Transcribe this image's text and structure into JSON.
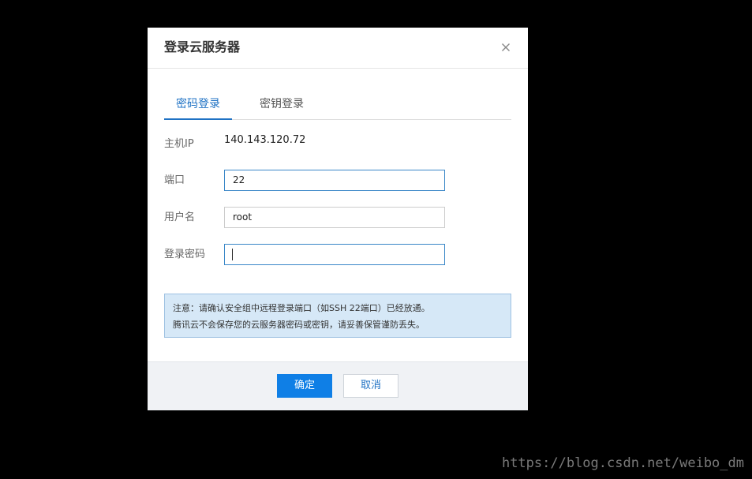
{
  "dialog": {
    "title": "登录云服务器",
    "close_icon": "close-icon"
  },
  "tabs": [
    {
      "label": "密码登录",
      "active": true
    },
    {
      "label": "密钥登录",
      "active": false
    }
  ],
  "form": {
    "host_ip": {
      "label": "主机IP",
      "value": "140.143.120.72"
    },
    "port": {
      "label": "端口",
      "value": "22"
    },
    "username": {
      "label": "用户名",
      "value": "root"
    },
    "password": {
      "label": "登录密码",
      "value": ""
    }
  },
  "notice": {
    "line1": "注意：请确认安全组中远程登录端口（如SSH 22端口）已经放通。",
    "line2": "腾讯云不会保存您的云服务器密码或密钥，请妥善保管谨防丢失。"
  },
  "footer": {
    "confirm_label": "确定",
    "cancel_label": "取消"
  },
  "watermark": "https://blog.csdn.net/weibo_dm",
  "colors": {
    "accent": "#1f72c4",
    "primary_button": "#0f7fe6",
    "notice_bg": "#d6e8f7",
    "backdrop": "#000000"
  }
}
